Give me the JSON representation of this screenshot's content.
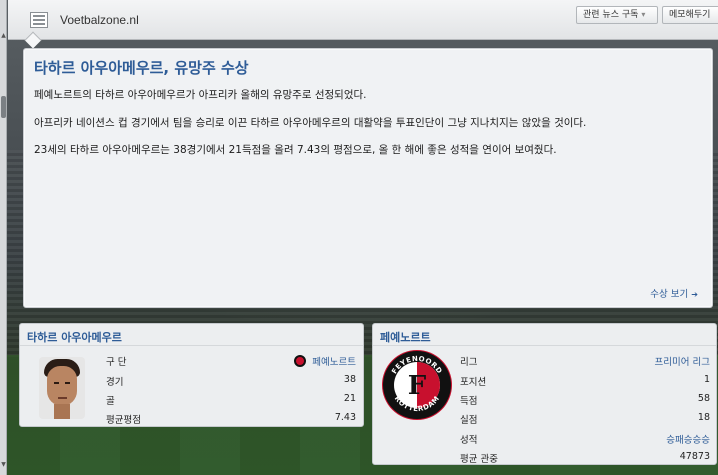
{
  "header": {
    "source_icon": "newspaper-icon",
    "source_name": "Voetbalzone.nl",
    "subscribe_label": "관련 뉴스 구독",
    "remember_label": "메모해두기"
  },
  "news": {
    "title": "타하르 아우아메우르, 유망주 수상",
    "paragraphs": [
      "페예노르트의 타하르 아우아메우르가 아프리카 올해의 유망주로 선정되었다.",
      "아프리카 네이션스 컵 경기에서 팀을 승리로 이끈 타하르 아우아메우르의 대활약을 투표인단이 그냥 지나치지는 않았을 것이다.",
      "23세의 타하르 아우아메우르는 38경기에서 21득점을 올려 7.43의 평점으로, 올 한 해에 좋은 성적을 연이어 보여줬다."
    ],
    "read_more": "수상 보기"
  },
  "player_card": {
    "title": "타하르 아우아메우르",
    "rows": [
      {
        "label": "구 단",
        "value": "페예노르트"
      },
      {
        "label": "경기",
        "value": "38"
      },
      {
        "label": "골",
        "value": "21"
      },
      {
        "label": "평균평점",
        "value": "7.43"
      }
    ]
  },
  "club_card": {
    "title": "페예노르트",
    "rows": [
      {
        "label": "리그",
        "value": "프리미어 리그"
      },
      {
        "label": "포지션",
        "value": "1"
      },
      {
        "label": "득점",
        "value": "58"
      },
      {
        "label": "실점",
        "value": "18"
      },
      {
        "label": "성적",
        "value": "승패승승승"
      },
      {
        "label": "평균 관중",
        "value": "47873"
      }
    ],
    "crest_text_top": "FEYENOORD",
    "crest_text_bottom": "ROTTERDAM",
    "crest_letter": "F"
  },
  "colors": {
    "accent": "#2e5c97",
    "club_red": "#c8102e"
  }
}
